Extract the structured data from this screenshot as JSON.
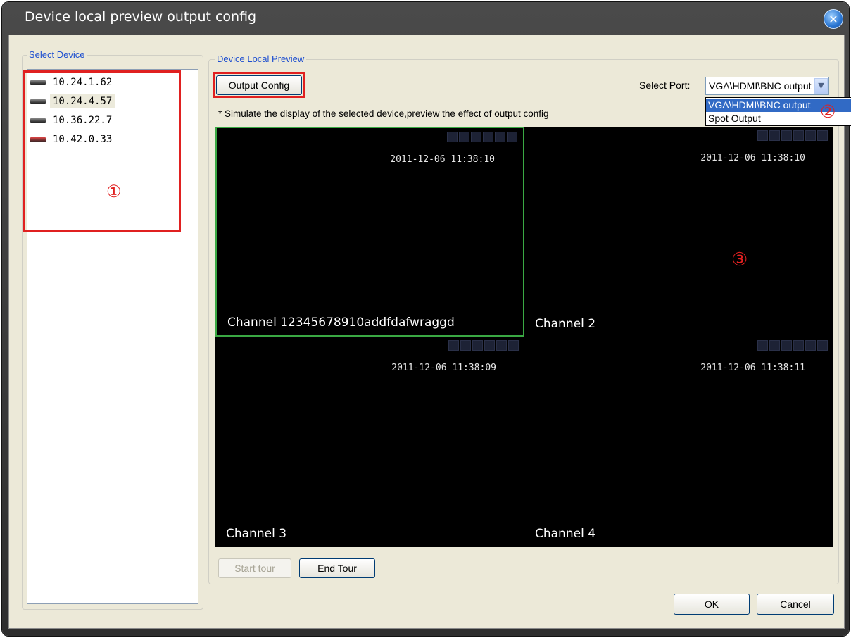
{
  "window": {
    "title": "Device local preview output config",
    "close_icon": "close-icon"
  },
  "select_device": {
    "label": "Select Device",
    "devices": [
      {
        "ip": "10.24.1.62",
        "icon": "dvr-icon"
      },
      {
        "ip": "10.24.4.57",
        "icon": "dvr-icon",
        "selected": true
      },
      {
        "ip": "10.36.22.7",
        "icon": "dvr-icon"
      },
      {
        "ip": "10.42.0.33",
        "icon": "dvr-icon-alert"
      }
    ]
  },
  "preview": {
    "label": "Device Local Preview",
    "output_config_button": "Output Config",
    "select_port_label": "Select Port:",
    "port_value": "VGA\\HDMI\\BNC output",
    "port_options": [
      "VGA\\HDMI\\BNC output",
      "Spot Output"
    ],
    "hint": "* Simulate the display of the selected device,preview the effect of  output config",
    "channels": [
      {
        "name": "Channel 12345678910addfdafwraggd",
        "time": "2011-12-06 11:38:10"
      },
      {
        "name": "Channel 2",
        "time": "2011-12-06 11:38:10"
      },
      {
        "name": "Channel 3",
        "time": "2011-12-06 11:38:09"
      },
      {
        "name": "Channel 4",
        "time": "2011-12-06 11:38:11"
      }
    ],
    "start_tour": "Start tour",
    "end_tour": "End Tour"
  },
  "dialog": {
    "ok": "OK",
    "cancel": "Cancel"
  },
  "annotations": {
    "marker1": "①",
    "marker2": "②",
    "marker3": "③"
  },
  "colors": {
    "annotation_red": "#e02020",
    "active_channel_border": "#3aa843",
    "selection_blue": "#316ac5"
  }
}
